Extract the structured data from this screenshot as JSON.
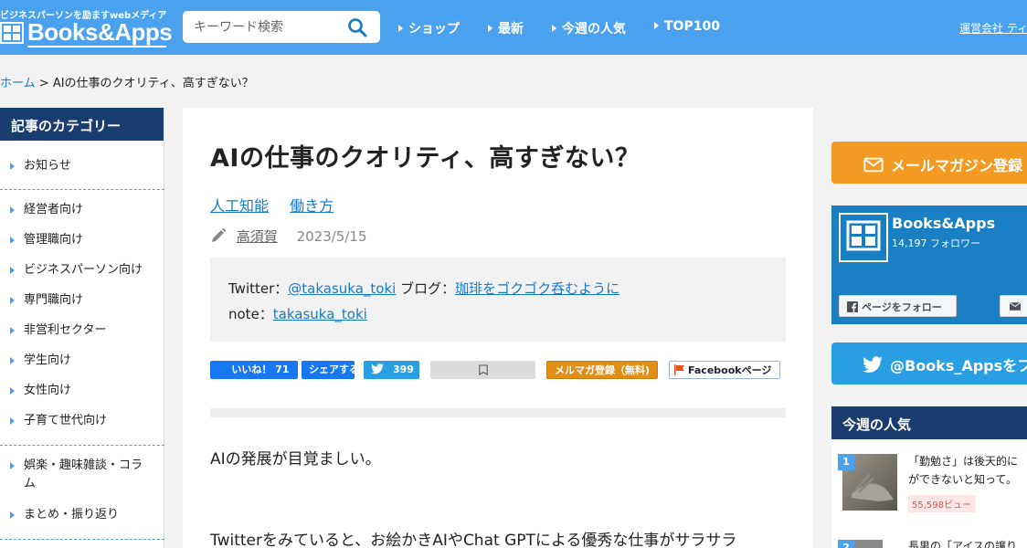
{
  "header": {
    "tagline": "ビジネスパーソンを励ますwebメディア",
    "site_name": "Books&Apps",
    "search_placeholder": "キーワード検索",
    "nav": [
      "ショップ",
      "最新",
      "今週の人気",
      "TOP100"
    ],
    "corp_link": "運営会社 ティ"
  },
  "breadcrumb": {
    "home": "ホーム",
    "sep": ">",
    "current": "AIの仕事のクオリティ、高すぎない？"
  },
  "sidebar": {
    "heading": "記事のカテゴリー",
    "items": [
      "お知らせ",
      "経営者向け",
      "管理職向け",
      "ビジネスパーソン向け",
      "専門職向け",
      "非営利セクター",
      "学生向け",
      "女性向け",
      "子育て世代向け",
      "娯楽・趣味雑談・コラ",
      "ム",
      "まとめ・振り返り"
    ]
  },
  "article": {
    "title": "AIの仕事のクオリティ、高すぎない？",
    "categories": [
      "人工知能",
      "働き方"
    ],
    "author": "高須賀",
    "date": "2023/5/15",
    "profile": {
      "twitter_label": "Twitter：",
      "twitter_handle": "@takasuka_toki",
      "blog_label": " ブログ：",
      "blog_name": "珈琲をゴクゴク呑むように",
      "note_label": "note：",
      "note_handle": "takasuka_toki"
    },
    "share": {
      "like": "いいね！ 71",
      "share": "シェアする",
      "tweet_count": "399",
      "mailmag": "メルマガ登録（無料)",
      "facebook_page": "Facebookページ"
    },
    "para1": "AIの発展が目覚ましい。",
    "para2": "Twitterをみていると、お絵かきAIやChat GPTによる優秀な仕事がサラサラ"
  },
  "right": {
    "mailmag_btn": "メールマガジン登録",
    "fb_name": "Books&Apps",
    "fb_followers": "14,197 フォロワー",
    "fb_follow_btn": "ページをフォロー",
    "twitter_btn": "@Books_Appsをフ",
    "weekly_heading": "今週の人気",
    "weekly_item": {
      "rank": "1",
      "title_line1": "「勤勉さ」は後天的に",
      "title_line2": "ができないと知って。",
      "views": "55,598ビュー"
    },
    "weekly_item2": {
      "rank": "2",
      "title": "長男の「アイスの譲り"
    }
  },
  "colors": {
    "header_bg": "#4aa2ef",
    "navy": "#1b3c6e",
    "link": "#1779c8",
    "orange": "#f39a22",
    "twitter": "#2a9ee3",
    "facebook": "#1877f2"
  }
}
